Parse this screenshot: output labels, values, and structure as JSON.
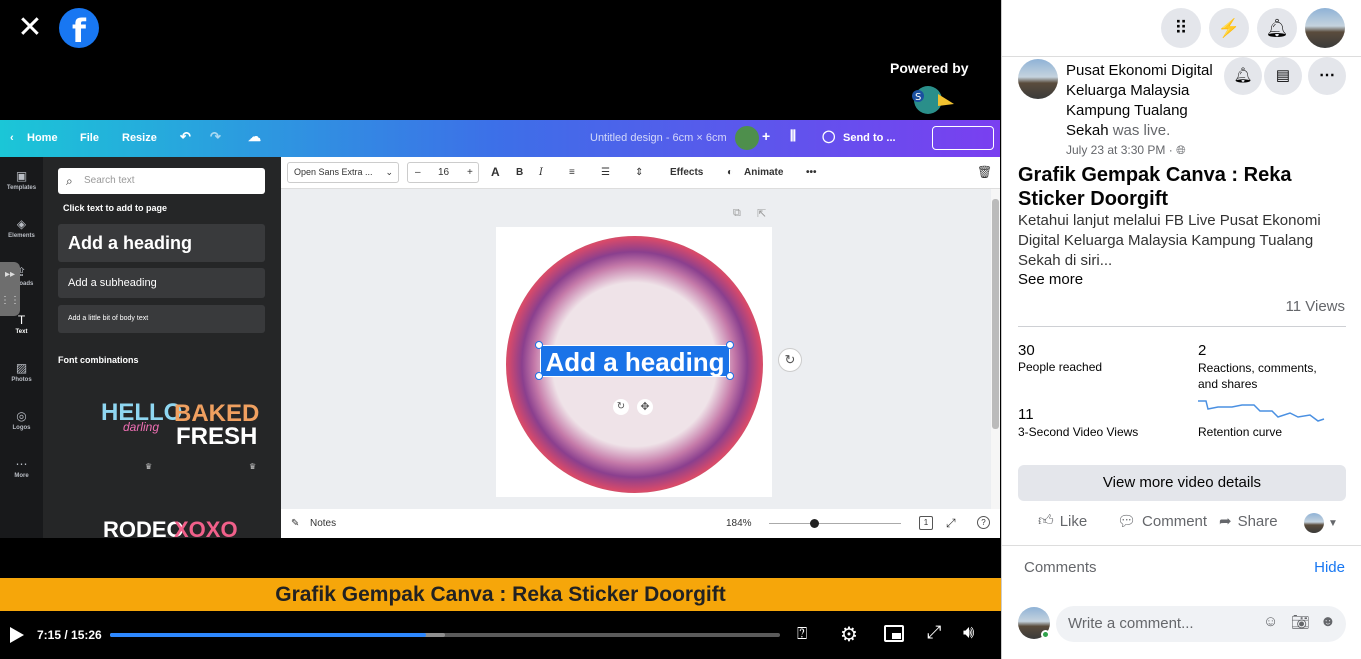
{
  "video": {
    "powered_by": "Powered by",
    "streamyard": "StreamYard",
    "banner_text": "Grafik Gempak Canva : Reka Sticker Doorgift",
    "time": "7:15 / 15:26",
    "progress": 0.472
  },
  "canva": {
    "nav": {
      "home": "Home",
      "file": "File",
      "resize": "Resize",
      "doc_title": "Untitled design - 6cm × 6cm",
      "share": "Send to ..."
    },
    "rail": [
      "Templates",
      "Elements",
      "Uploads",
      "Text",
      "Photos",
      "Logos",
      "More"
    ],
    "panel": {
      "search_placeholder": "Search text",
      "hint": "Click text to add to page",
      "heading": "Add a heading",
      "subheading": "Add a subheading",
      "body": "Add a little bit of body text",
      "combos_title": "Font combinations",
      "combo1a": "HELLO",
      "combo1b": "darling",
      "combo2a": "BAKED",
      "combo2b": "FRESH",
      "combo3": "RODEO",
      "combo4": "XOXO"
    },
    "toolbar": {
      "font": "Open Sans Extra ...",
      "size": "16",
      "effects": "Effects",
      "animate": "Animate"
    },
    "canvas_heading": "Add a heading",
    "bottom": {
      "notes": "Notes",
      "zoom": "184%",
      "page": "1"
    }
  },
  "side": {
    "page_name": "Pusat Ekonomi Digital Keluarga Malaysia Kampung Tualang Sekah",
    "was_live": "was live.",
    "date": "July 23 at 3:30 PM · ",
    "title": "Grafik Gempak Canva : Reka Sticker Doorgift",
    "description": "Ketahui lanjut melalui FB Live Pusat Ekonomi Digital Keluarga Malaysia Kampung Tualang Sekah di siri...",
    "see_more": "See more",
    "views": "11 Views",
    "stats": [
      {
        "value": "30",
        "label": "People reached"
      },
      {
        "value": "2",
        "label": "Reactions, comments, and shares"
      },
      {
        "value": "11",
        "label": "3-Second Video Views"
      },
      {
        "value": "",
        "label": "Retention curve"
      }
    ],
    "view_details": "View more video details",
    "like": "Like",
    "comment": "Comment",
    "share": "Share",
    "comments_header": "Comments",
    "hide": "Hide",
    "comment_placeholder": "Write a comment..."
  }
}
